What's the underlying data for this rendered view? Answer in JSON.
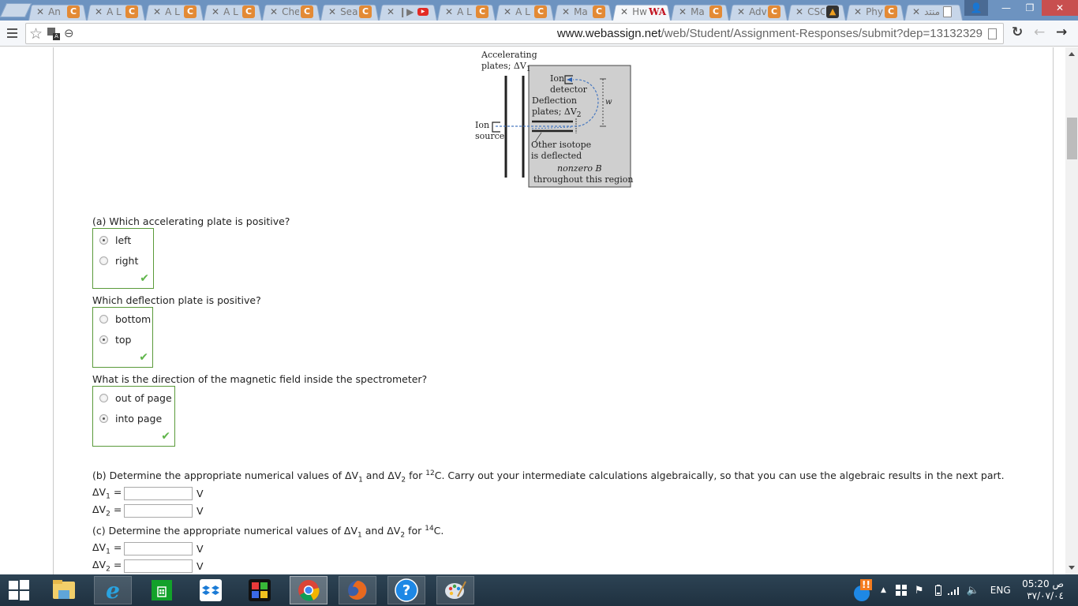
{
  "browser": {
    "tabs": [
      {
        "label": "An",
        "favicon": "chegg-icon",
        "active": false
      },
      {
        "label": "A L",
        "favicon": "chegg-icon",
        "active": false
      },
      {
        "label": "A L",
        "favicon": "chegg-icon",
        "active": false
      },
      {
        "label": "A L",
        "favicon": "chegg-icon",
        "active": false
      },
      {
        "label": "Che",
        "favicon": "chegg-icon",
        "active": false
      },
      {
        "label": "Sea",
        "favicon": "chegg-icon",
        "active": false
      },
      {
        "label": "❙▶ ,",
        "favicon": "youtube-icon",
        "active": false
      },
      {
        "label": "A L",
        "favicon": "chegg-icon",
        "active": false
      },
      {
        "label": "A L",
        "favicon": "chegg-icon",
        "active": false
      },
      {
        "label": "Ma",
        "favicon": "chegg-icon",
        "active": false
      },
      {
        "label": "Hw",
        "favicon": "webassign-icon",
        "active": true
      },
      {
        "label": "Ma",
        "favicon": "chegg-icon",
        "active": false
      },
      {
        "label": "Adv",
        "favicon": "chegg-icon",
        "active": false
      },
      {
        "label": "CSC",
        "favicon": "csc-icon",
        "active": false
      },
      {
        "label": "Phy",
        "favicon": "chegg-icon",
        "active": false
      },
      {
        "label": "منتد",
        "favicon": "page-icon",
        "active": false
      }
    ],
    "tab_close_glyph": "✕",
    "favicon_glyphs": {
      "chegg": "C",
      "youtube": "▶",
      "webassign": "WA",
      "csc": "▲"
    },
    "url_host": "www.webassign.net",
    "url_path": "/web/Student/Assignment-Responses/submit?dep=13132329",
    "window_controls": {
      "user": "👤",
      "minimize": "—",
      "restore": "❐",
      "close": "✕"
    },
    "toolbar_glyphs": {
      "star": "☆",
      "zoom": "⊖",
      "reload": "↻",
      "back": "←",
      "forward": "→",
      "translate": "A"
    }
  },
  "diagram": {
    "accelerating_label_1": "Accelerating",
    "accelerating_label_2": "plates; ΔV",
    "accelerating_sub": "1",
    "ion_detector_1": "Ion",
    "ion_detector_2": "detector",
    "deflection_1": "Deflection",
    "deflection_2": "plates; ΔV",
    "deflection_sub": "2",
    "w_label": "w",
    "ion_source_1": "Ion",
    "ion_source_2": "source",
    "other_isotope_1": "Other isotope",
    "other_isotope_2": "is deflected",
    "nonzero_b": "nonzero B",
    "region": "throughout this region"
  },
  "part_a": {
    "question": "(a) Which accelerating plate is positive?",
    "options": [
      {
        "label": "left",
        "selected": true
      },
      {
        "label": "right",
        "selected": false
      }
    ],
    "correct": true
  },
  "deflection_q": {
    "question": "Which deflection plate is positive?",
    "options": [
      {
        "label": "bottom",
        "selected": false
      },
      {
        "label": "top",
        "selected": true
      }
    ],
    "correct": true
  },
  "field_q": {
    "question": "What is the direction of the magnetic field inside the spectrometer?",
    "options": [
      {
        "label": "out of page",
        "selected": false
      },
      {
        "label": "into page",
        "selected": true
      }
    ],
    "correct": true
  },
  "check_glyph": "✔",
  "part_b": {
    "q_pre": "(b) Determine the appropriate numerical values of ΔV",
    "q_sub1": "1",
    "q_and": " and ΔV",
    "q_sub2": "2",
    "q_for": " for ",
    "q_sup": "12",
    "q_post": "C. Carry out your intermediate calculations algebraically, so that you can use the algebraic results in the next part.",
    "fields": [
      {
        "label": "ΔV",
        "sub": "1",
        "eq": " =",
        "value": "",
        "unit": "V"
      },
      {
        "label": "ΔV",
        "sub": "2",
        "eq": " =",
        "value": "",
        "unit": "V"
      }
    ]
  },
  "part_c": {
    "q_pre": "(c) Determine the appropriate numerical values of ΔV",
    "q_sub1": "1",
    "q_and": " and ΔV",
    "q_sub2": "2",
    "q_for": " for ",
    "q_sup": "14",
    "q_post": "C.",
    "fields": [
      {
        "label": "ΔV",
        "sub": "1",
        "eq": " =",
        "value": "",
        "unit": "V"
      },
      {
        "label": "ΔV",
        "sub": "2",
        "eq": " =",
        "value": "",
        "unit": "V"
      }
    ]
  },
  "taskbar": {
    "apps": [
      "start",
      "file-explorer",
      "internet-explorer",
      "store",
      "dropbox",
      "puzzle-app",
      "chrome",
      "firefox",
      "help",
      "paint"
    ],
    "tray": {
      "notification_badge": "!!",
      "language": "ENG",
      "time": "05:20 ص",
      "date": "٣٧/٠٧/٠٤"
    }
  }
}
